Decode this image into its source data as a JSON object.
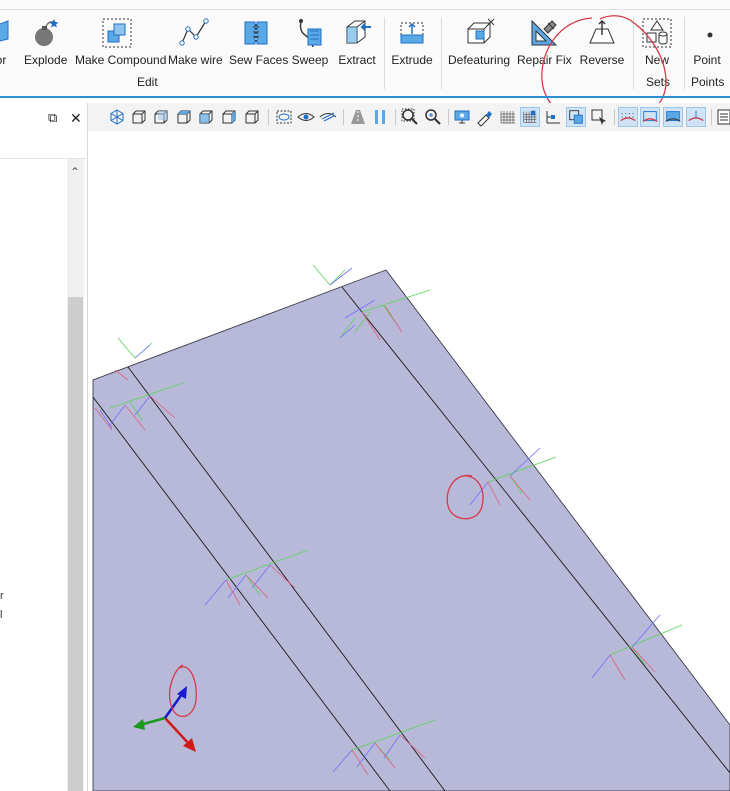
{
  "ribbon": {
    "partial_left_label": "or",
    "tools": [
      {
        "name": "explode",
        "label": "Explode"
      },
      {
        "name": "make-compound",
        "label": "Make Compound"
      },
      {
        "name": "make-wire",
        "label": "Make wire"
      },
      {
        "name": "sew-faces",
        "label": "Sew Faces"
      },
      {
        "name": "sweep",
        "label": "Sweep"
      },
      {
        "name": "extract",
        "label": "Extract"
      },
      {
        "name": "extrude",
        "label": "Extrude"
      },
      {
        "name": "defeaturing",
        "label": "Defeaturing"
      },
      {
        "name": "repair-fix",
        "label": "Repair Fix"
      },
      {
        "name": "reverse",
        "label": "Reverse"
      },
      {
        "name": "new",
        "label": "New"
      },
      {
        "name": "point",
        "label": "Point"
      }
    ],
    "groups": {
      "edit": "Edit",
      "sets": "Sets",
      "points": "Points"
    }
  },
  "left_panel": {
    "restore_symbol": "⧉",
    "close_symbol": "✕",
    "scroll_up_symbol": "⌃",
    "partial_text_1": "r",
    "partial_text_2": "l"
  },
  "viewport": {
    "face_color": "#b8b8d8",
    "annotation_color": "#d63a4a",
    "axis_colors": {
      "x": "#d01a1a",
      "y": "#1a9a1a",
      "z": "#1a1ad0"
    }
  },
  "colors": {
    "accent": "#2b8fd6",
    "icon_blue": "#1f6fc5"
  }
}
